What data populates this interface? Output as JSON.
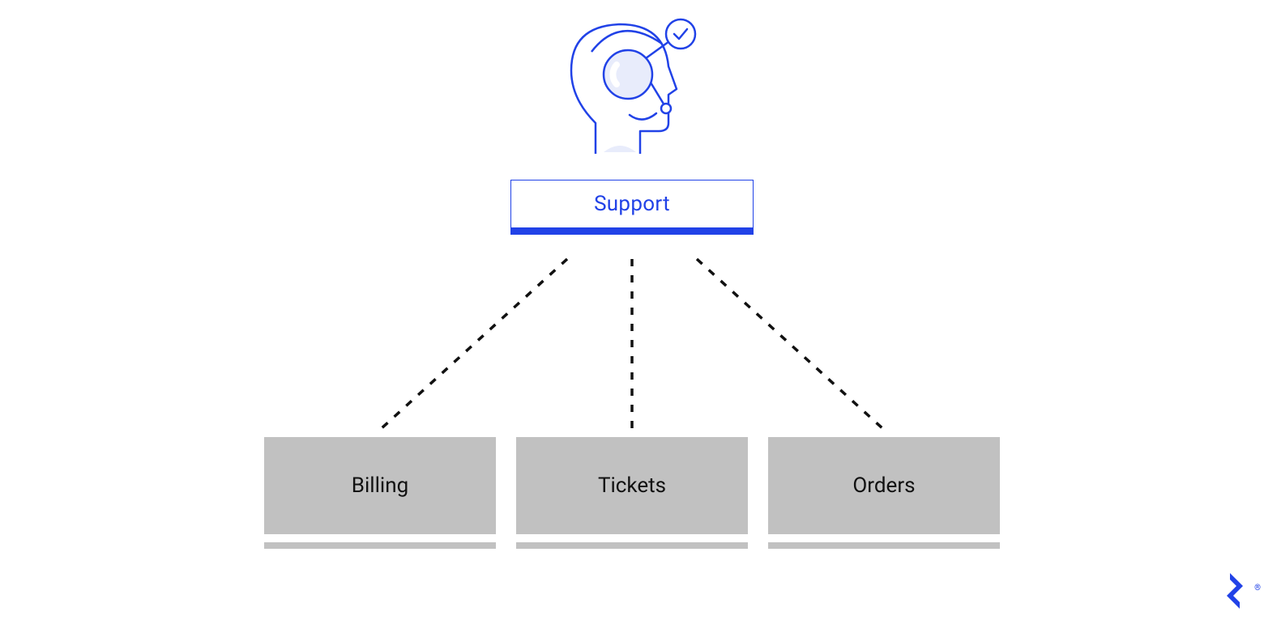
{
  "root": {
    "label": "Support"
  },
  "children": [
    {
      "label": "Billing"
    },
    {
      "label": "Tickets"
    },
    {
      "label": "Orders"
    }
  ],
  "colors": {
    "accent": "#2142e7",
    "childFill": "#c1c1c1"
  },
  "logo": {
    "name": "toptal-logo",
    "registered": "®"
  }
}
